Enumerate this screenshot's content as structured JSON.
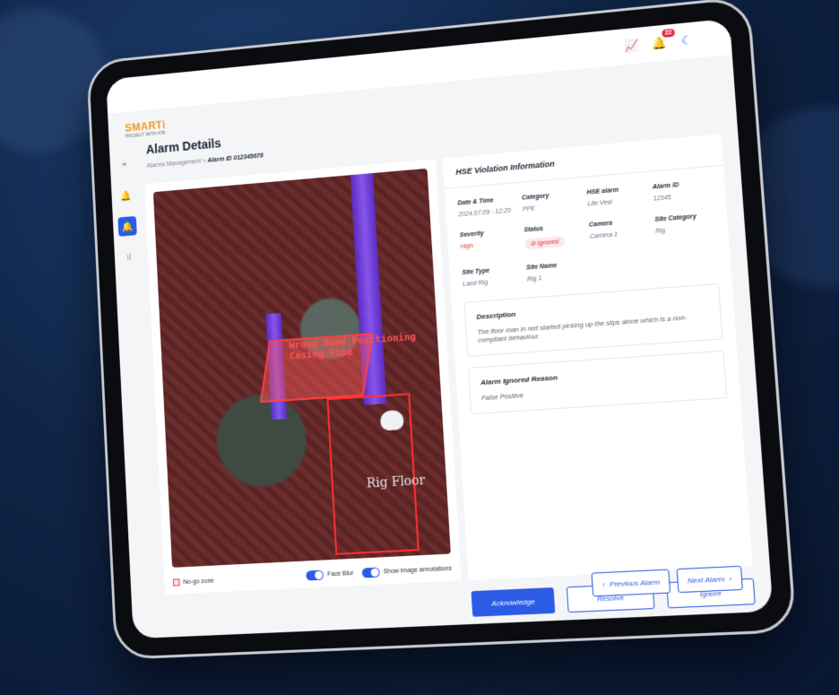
{
  "app": {
    "logo_text": "SMARTi",
    "logo_subtext": "PROJECT WITH ATB",
    "notification_count": "22"
  },
  "header": {
    "title": "Alarm Details",
    "breadcrumb_parent": "Alarms Management",
    "breadcrumb_separator": ">",
    "breadcrumb_current": "Alarm ID 012345678"
  },
  "image_panel": {
    "annotation_primary": "Wrong Hand Positioning",
    "annotation_secondary": "Casing Pipe",
    "zone_label": "Rig Floor",
    "legend_nogo": "No-go zone",
    "toggle_face_blur": "Face Blur",
    "toggle_annotations": "Show image annotations"
  },
  "violation": {
    "section_title": "HSE Violation Information",
    "fields": [
      {
        "label": "Date & Time",
        "value": "2024.07.09 - 12:20"
      },
      {
        "label": "Category",
        "value": "PPE"
      },
      {
        "label": "HSE alarm",
        "value": "Life Vest"
      },
      {
        "label": "Alarm ID",
        "value": "12345"
      },
      {
        "label": "Severity",
        "value": "High"
      },
      {
        "label": "Status",
        "value": "⊘ Ignored"
      },
      {
        "label": "Camera",
        "value": "Camera 1"
      },
      {
        "label": "Site Category",
        "value": "Rig"
      },
      {
        "label": "Site Type",
        "value": "Land Rig"
      },
      {
        "label": "Site Name",
        "value": "Rig 1"
      }
    ],
    "description_title": "Description",
    "description_text": "The floor man in red started picking up the slips alone which is a non-compliant behaviour.",
    "ignored_reason_title": "Alarm Ignored Reason",
    "ignored_reason_text": "False Positive"
  },
  "actions": {
    "acknowledge": "Acknowledge",
    "resolve": "Resolve",
    "ignore": "Ignore",
    "previous": "Previous Alarm",
    "next": "Next Alarm"
  },
  "colors": {
    "accent": "#2b5ce6",
    "danger": "#e23b3b",
    "brand": "#f29a1d"
  }
}
